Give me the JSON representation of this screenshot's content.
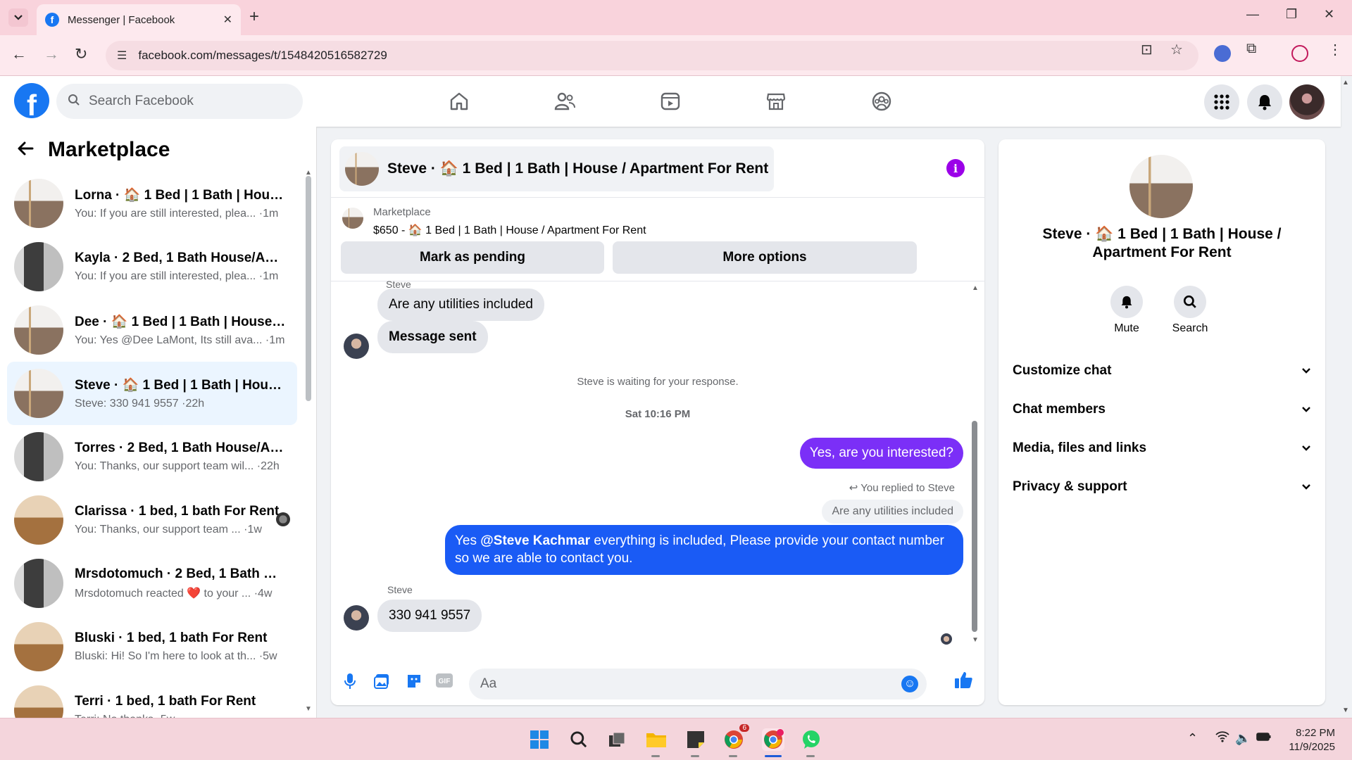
{
  "browser": {
    "tab_title": "Messenger | Facebook",
    "url": "facebook.com/messages/t/1548420516582729"
  },
  "fb_nav": {
    "search_placeholder": "Search Facebook"
  },
  "sidebar": {
    "title": "Marketplace",
    "conversations": [
      {
        "name": "Lorna · 🏠 1 Bed | 1 Bath | House...",
        "preview": "You: If you are still interested, plea... ·1m",
        "thumb": "house-thumb",
        "active": false
      },
      {
        "name": "Kayla · 2 Bed, 1 Bath House/Apa...",
        "preview": "You: If you are still interested, plea... ·1m",
        "thumb": "kitchen-thumb",
        "active": false
      },
      {
        "name": "Dee · 🏠 1 Bed | 1 Bath | House / ...",
        "preview": "You: Yes @Dee LaMont, Its still ava... ·1m",
        "thumb": "house-thumb",
        "active": false
      },
      {
        "name": "Steve · 🏠 1 Bed | 1 Bath | House ...",
        "preview": "Steve: 330 941 9557 ·22h",
        "thumb": "house-thumb",
        "active": true
      },
      {
        "name": "Torres · 2 Bed, 1 Bath House/Ap...",
        "preview": "You: Thanks, our support team wil... ·22h",
        "thumb": "kitchen-thumb",
        "active": false
      },
      {
        "name": "Clarissa · 1 bed, 1 bath For Rent",
        "preview": "You: Thanks, our support team ... ·1w",
        "thumb": "room-thumb",
        "active": false
      },
      {
        "name": "Mrsdotomuch · 2 Bed, 1 Bath Ho...",
        "preview": "Mrsdotomuch reacted ❤️ to your ... ·4w",
        "thumb": "kitchen-thumb",
        "active": false
      },
      {
        "name": "Bluski · 1 bed, 1 bath For Rent",
        "preview": "Bluski: Hi! So I'm here to look at th... ·5w",
        "thumb": "room-thumb",
        "active": false
      },
      {
        "name": "Terri · 1 bed, 1 bath For Rent",
        "preview": "Terri: No thanks ·5w",
        "thumb": "room-thumb",
        "active": false
      }
    ]
  },
  "chat": {
    "header_name": "Steve · 🏠 1 Bed | 1 Bath | House / Apartment For Rent",
    "marketplace_label": "Marketplace",
    "listing": "$650 - 🏠 1 Bed | 1 Bath | House / Apartment For Rent",
    "mark_pending": "Mark as pending",
    "more_options": "More options",
    "top_sender": "Steve",
    "msg_utilities": "Are any utilities included",
    "msg_sent": "Message sent",
    "waiting": "Steve is waiting for your response.",
    "timestamp": "Sat 10:16 PM",
    "out_interested": "Yes, are you interested?",
    "reply_note": "You replied to Steve",
    "quoted": "Are any utilities included",
    "out_reply_prefix": "Yes ",
    "out_reply_mention": "@Steve Kachmar",
    "out_reply_rest": " everything is included, Please provide  your contact number so we are able to contact you.",
    "sender_label": "Steve",
    "msg_phone": "330 941 9557",
    "composer_placeholder": "Aa"
  },
  "info_panel": {
    "name": "Steve · 🏠 1 Bed | 1 Bath | House / Apartment For Rent",
    "mute": "Mute",
    "search": "Search",
    "sections": [
      "Customize chat",
      "Chat members",
      "Media, files and links",
      "Privacy & support"
    ]
  },
  "taskbar": {
    "time": "8:22 PM",
    "date": "11/9/2025",
    "chrome_badge": "6"
  },
  "colors": {
    "fb_blue": "#1877f2",
    "outgoing_purple": "#7b2ff7",
    "outgoing_blue": "#1a5bf5",
    "info_purple": "#9b00e8"
  }
}
